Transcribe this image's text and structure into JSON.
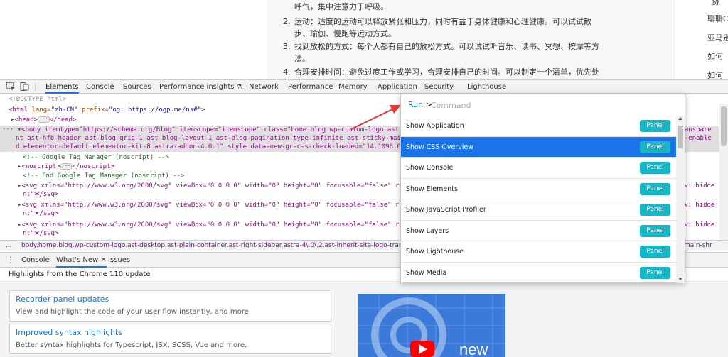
{
  "webpage": {
    "article_lines": [
      {
        "num": "",
        "text": "呼气，集中注意力于呼吸。"
      },
      {
        "num": "2.",
        "text": "运动：适度的运动可以释放紧张和压力，同时有益于身体健康和心理健康。可以试试散"
      },
      {
        "num": "",
        "text": "步、瑜伽、慢跑等运动方式。"
      },
      {
        "num": "3.",
        "text": "找到放松的方式：每个人都有自己的放松方式。可以试试听音乐、读书、冥想、按摩等方"
      },
      {
        "num": "",
        "text": "法。"
      },
      {
        "num": "4.",
        "text": "合理安排时间：避免过度工作或学习，合理安排自己的时间。可以制定一个清单，优先处"
      }
    ],
    "right_links": [
      "协",
      "聊聊C",
      "亚马逊",
      "如何",
      "如何"
    ]
  },
  "devtools": {
    "tabs": [
      "Elements",
      "Console",
      "Sources",
      "Performance insights",
      "Network",
      "Performance",
      "Memory",
      "Application",
      "Security",
      "Lighthouse"
    ],
    "active_tab": "Elements",
    "breadcrumb": "body.home.blog.wp-custom-logo.ast-desktop.ast-plain-container.ast-right-sidebar.astra-4\\.0\\.2.ast-inherit-site-logo-transparent",
    "breadcrumb_right": "main-shr",
    "dom": {
      "doctype": "<!DOCTYPE html>",
      "html_open": "<html",
      "html_lang_attr": " lang=",
      "html_lang_val": "\"zh-CN\"",
      "html_prefix_attr": " prefix=",
      "html_prefix_val": "\"og: https://ogp.me/ns#\"",
      "head": "<head>",
      "head_close": "</head>",
      "body_line1": "<body itemtype=\"https://schema.org/Blog\" itemscope=\"itemscope\" class=\"home blog wp-custom-logo ast-desk",
      "body_line1_right": "transpare",
      "body_line2": "nt ast-hfb-header ast-blog-grid-1 ast-blog-layout-1 ast-blog-pagination-type-infinite ast-sticky-main-s",
      "body_line2_right": "ky-enable",
      "body_line3": "d elementor-default elementor-kit-8 astra-addon-4.0.1\" style data-new-gr-c-s-check-loaded=\"14.1098.0\" d",
      "comment1": "<!-- Google Tag Manager (noscript) -->",
      "noscript": "<noscript>",
      "noscript_close": "</noscript>",
      "comment2": "<!-- End Google Tag Manager (noscript) -->",
      "svg_line": "<svg xmlns=\"http://www.w3.org/2000/svg\" viewBox=\"0 0 0 0\" width=\"0\" height=\"0\" focusable=\"false\" role=",
      "svg_right": "w: hidde",
      "svg_cont": "n;\">",
      "svg_close": "</svg>"
    }
  },
  "command_menu": {
    "prefix": "Run",
    "caret": ">",
    "placeholder": "Command",
    "items": [
      {
        "label": "Show Application",
        "badge": "Panel"
      },
      {
        "label": "Show CSS Overview",
        "badge": "Panel"
      },
      {
        "label": "Show Console",
        "badge": "Panel"
      },
      {
        "label": "Show Elements",
        "badge": "Panel"
      },
      {
        "label": "Show JavaScript Profiler",
        "badge": "Panel"
      },
      {
        "label": "Show Layers",
        "badge": "Panel"
      },
      {
        "label": "Show Lighthouse",
        "badge": "Panel"
      },
      {
        "label": "Show Media",
        "badge": "Panel"
      }
    ],
    "selected": "Show CSS Overview"
  },
  "drawer": {
    "tabs": [
      "Console",
      "What's New",
      "Issues"
    ],
    "active": "What's New",
    "header": "Highlights from the Chrome 110 update",
    "cards": [
      {
        "title": "Recorder panel updates",
        "desc": "View and highlight the code of your user flow instantly, and more."
      },
      {
        "title": "Improved syntax highlights",
        "desc": "Better syntax highlights for Typescript, JSX, SCSS, Vue and more."
      }
    ],
    "promo_text": "new"
  },
  "colors": {
    "accent": "#1a73e8",
    "panel_badge": "#16b6c7",
    "arrow": "#e53935"
  }
}
